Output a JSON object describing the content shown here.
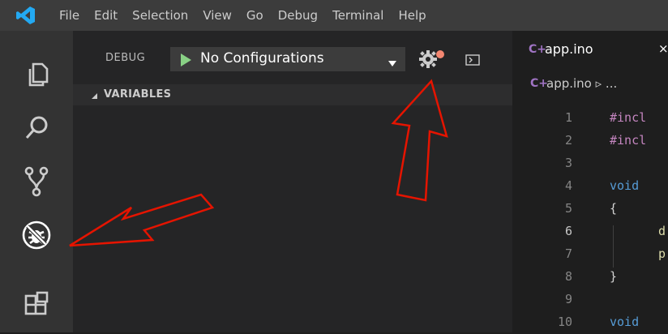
{
  "menu": {
    "logo_icon": "vscode-logo-icon",
    "items": [
      "File",
      "Edit",
      "Selection",
      "View",
      "Go",
      "Debug",
      "Terminal",
      "Help"
    ]
  },
  "activity_bar": {
    "icons": [
      "explorer-icon",
      "search-icon",
      "source-control-icon",
      "debug-icon",
      "extensions-icon"
    ]
  },
  "debug": {
    "label": "DEBUG",
    "config_value": "No Configurations",
    "start_icon": "play-icon",
    "settings_icon": "gear-icon",
    "console_icon": "debug-console-icon"
  },
  "variables": {
    "header": "VARIABLES"
  },
  "editor": {
    "tab_label": "app.ino",
    "tab_close": "×",
    "breadcrumb": "app.ino ▹ ...",
    "lines": [
      {
        "num": "1",
        "text": "#incl",
        "kind": "include"
      },
      {
        "num": "2",
        "text": "#incl",
        "kind": "include"
      },
      {
        "num": "3",
        "text": "",
        "kind": "blank"
      },
      {
        "num": "4",
        "text": "void",
        "kind": "type"
      },
      {
        "num": "5",
        "text": "{",
        "kind": "punct"
      },
      {
        "num": "6",
        "text": "d",
        "kind": "ident"
      },
      {
        "num": "7",
        "text": "p",
        "kind": "ident"
      },
      {
        "num": "8",
        "text": "}",
        "kind": "punct"
      },
      {
        "num": "9",
        "text": "",
        "kind": "blank"
      },
      {
        "num": "10",
        "text": "void",
        "kind": "type"
      }
    ]
  },
  "colors": {
    "accent_blue": "#0078d4",
    "play_green": "#89d185",
    "annotation_red": "#e51400",
    "gear_badge": "#f48771"
  }
}
